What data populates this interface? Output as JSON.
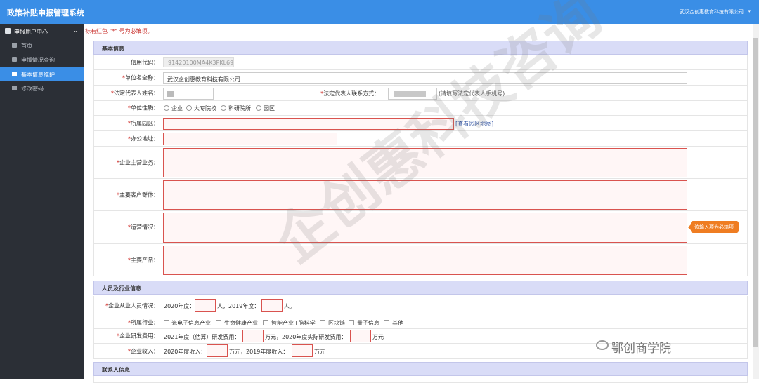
{
  "app": {
    "title": "政策补贴申报管理系统",
    "company": "武汉企创惠教育科技有限公司",
    "caret": "▾"
  },
  "sidebar": {
    "header": "申报用户中心",
    "chevron": "⌄",
    "items": [
      {
        "label": "首页",
        "active": false
      },
      {
        "label": "申报情况查询",
        "active": false
      },
      {
        "label": "基本信息维护",
        "active": true
      },
      {
        "label": "修改密码",
        "active": false
      }
    ]
  },
  "notice": "标有红色 \"*\" 号为必填项。",
  "basic": {
    "title": "基本信息",
    "credit_label": "信用代码：",
    "credit_value": "91420100MA4K3PKL69",
    "name_label": "单位名全称：",
    "name_value": "武汉企创惠教育科技有限公司",
    "legal_name_label": "法定代表人姓名：",
    "legal_contact_label": "法定代表人联系方式：",
    "legal_contact_hint": "(请填写法定代表人手机号)",
    "nature_label": "单位性质：",
    "nature_options": [
      "企业",
      "大专院校",
      "科研院所",
      "园区"
    ],
    "park_label": "所属园区：",
    "park_link": "[查看园区地图]",
    "address_label": "办公地址：",
    "business_label": "企业主营业务：",
    "customers_label": "主要客户群体：",
    "operation_label": "运营情况：",
    "products_label": "主要产品：",
    "tooltip": "该输入项为必输项"
  },
  "industry": {
    "title": "人员及行业信息",
    "staff_label": "企业从业人员情况：",
    "staff_year1": "2020年度：",
    "staff_unit_sep": "人，2019年度：",
    "staff_unit_end": "人。",
    "sector_label": "所属行业：",
    "sector_options": [
      "光电子信息产业",
      "生命健康产业",
      "智能产业+脑科学",
      "区块链",
      "量子信息",
      "其他"
    ],
    "rnd_label": "企业研发费用：",
    "rnd_text1": "2021年度（估算）研发费用：",
    "rnd_text2": "万元，2020年度实际研发费用：",
    "rnd_text3": "万元",
    "income_label": "企业收入：",
    "income_text1": "2020年度收入：",
    "income_text2": "万元，2019年度收入：",
    "income_text3": "万元"
  },
  "contact": {
    "title": "联系人信息"
  },
  "required_mark": "*",
  "watermark": "企创惠科技咨询",
  "brand": "鄂创商学院"
}
